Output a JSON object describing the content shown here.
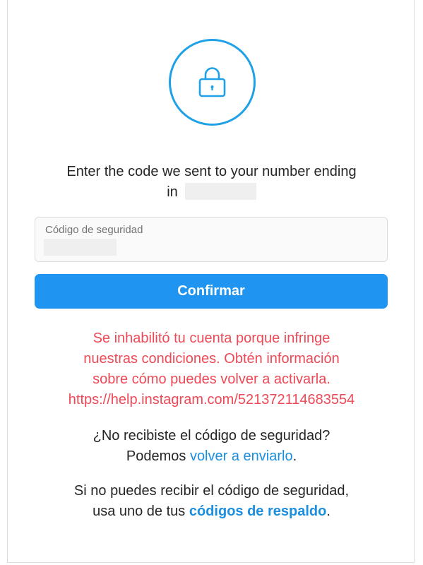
{
  "icon": {
    "name": "lock-icon",
    "accent": "#1ea1e6"
  },
  "prompt": {
    "line1": "Enter the code we sent to your number ending",
    "line2_prefix": "in"
  },
  "code_field": {
    "label": "Código de seguridad"
  },
  "confirm_button": {
    "label": "Confirmar",
    "color": "#1f95f1"
  },
  "error": {
    "color": "#ed4956",
    "lines": [
      "Se inhabilitó tu cuenta porque infringe",
      "nuestras condiciones. Obtén información",
      "sobre cómo puedes volver a activarla.",
      "https://help.instagram.com/521372114683554"
    ]
  },
  "resend": {
    "question": "¿No recibiste el código de seguridad?",
    "prefix": "Podemos ",
    "link": "volver a enviarlo",
    "suffix": "."
  },
  "backup": {
    "line1": "Si no puedes recibir el código de seguridad,",
    "prefix": "usa uno de tus ",
    "link": "códigos de respaldo",
    "suffix": "."
  }
}
